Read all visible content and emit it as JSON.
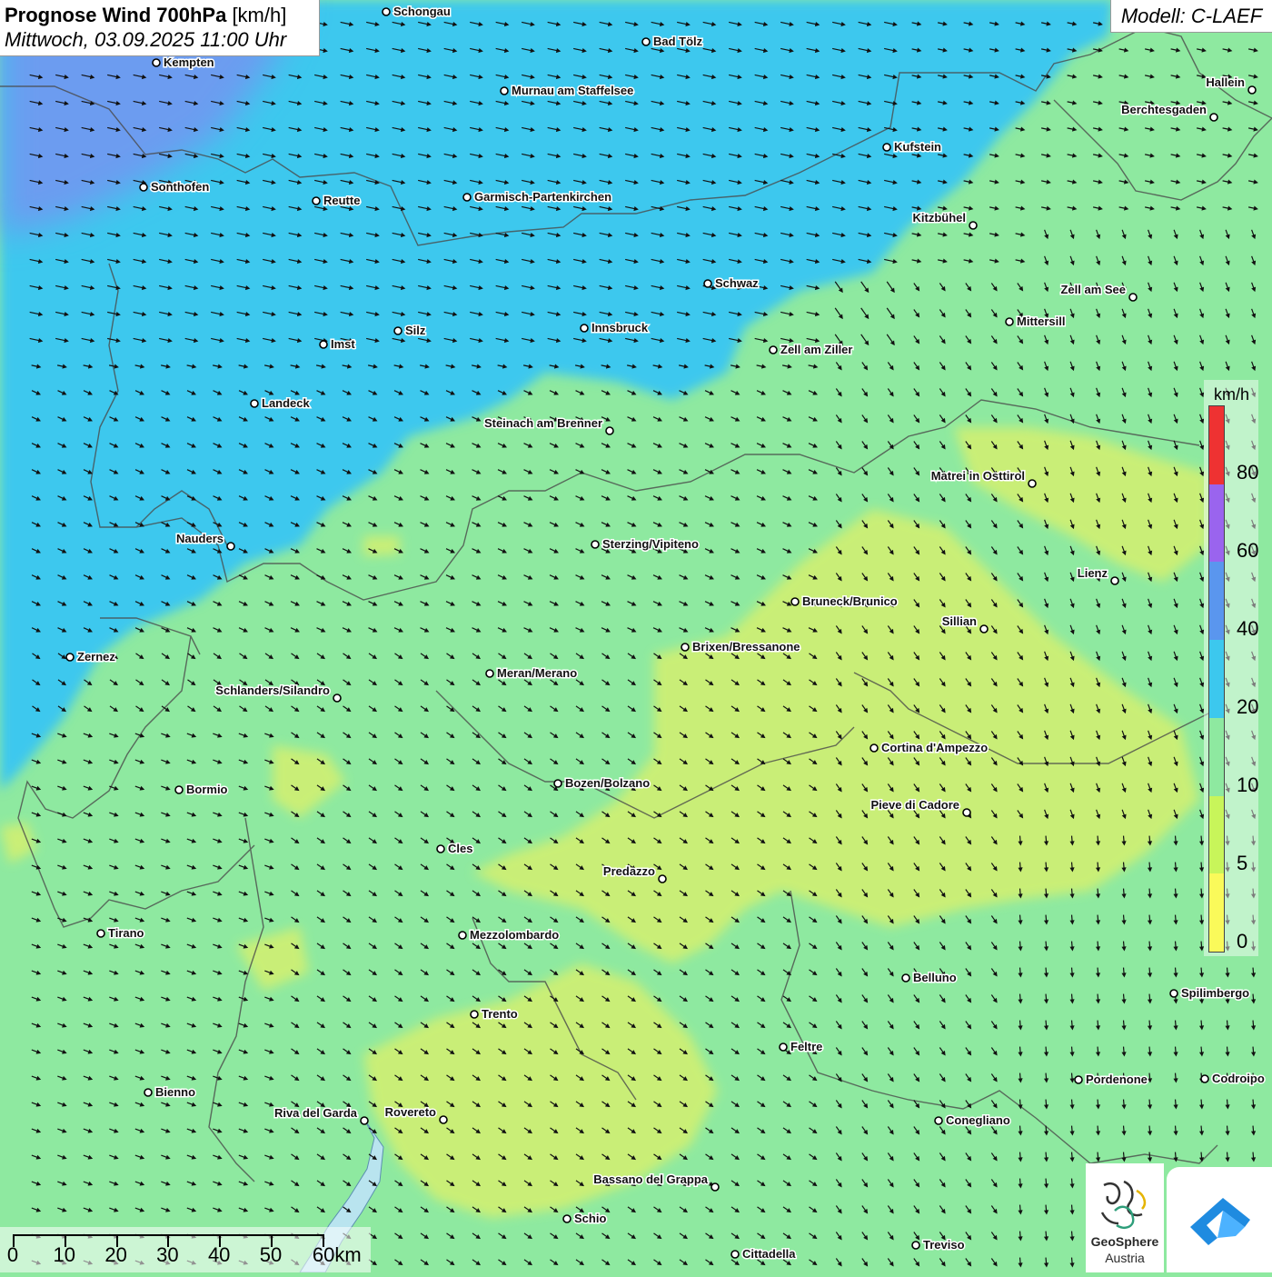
{
  "title": {
    "main": "Prognose Wind 700hPa",
    "unit": "[km/h]",
    "datetime": "Mittwoch, 03.09.2025 11:00 Uhr"
  },
  "model": "Modell: C-LAEF",
  "legend": {
    "unit": "km/h",
    "labels": [
      "0",
      "5",
      "10",
      "20",
      "40",
      "60",
      "80"
    ],
    "colors": [
      "#fafa5a",
      "#c8f55a",
      "#8ee9a0",
      "#3cc8ee",
      "#5a96ee",
      "#9a64ee",
      "#ee3232"
    ]
  },
  "scale_bar": {
    "labels": [
      "0",
      "10",
      "20",
      "30",
      "40",
      "50",
      "60km"
    ]
  },
  "logos": {
    "geosphere_line1": "GeoSphere",
    "geosphere_line2": "Austria"
  },
  "cities": [
    {
      "name": "Schongau"
    },
    {
      "name": "Bad Tölz"
    },
    {
      "name": "Kempten"
    },
    {
      "name": "Murnau am Staffelsee"
    },
    {
      "name": "Hallein"
    },
    {
      "name": "Berchtesgaden"
    },
    {
      "name": "Kufstein"
    },
    {
      "name": "Sonthofen"
    },
    {
      "name": "Reutte"
    },
    {
      "name": "Garmisch-Partenkirchen"
    },
    {
      "name": "Kitzbühel"
    },
    {
      "name": "Schwaz"
    },
    {
      "name": "Zell am See"
    },
    {
      "name": "Mittersill"
    },
    {
      "name": "Innsbruck"
    },
    {
      "name": "Imst"
    },
    {
      "name": "Silz"
    },
    {
      "name": "Zell am Ziller"
    },
    {
      "name": "Landeck"
    },
    {
      "name": "Steinach am Brenner"
    },
    {
      "name": "Matrei in Osttirol"
    },
    {
      "name": "Nauders"
    },
    {
      "name": "Sterzing/Vipiteno"
    },
    {
      "name": "Lienz"
    },
    {
      "name": "Bruneck/Brunico"
    },
    {
      "name": "Sillian"
    },
    {
      "name": "Brixen/Bressanone"
    },
    {
      "name": "Zernez"
    },
    {
      "name": "Meran/Merano"
    },
    {
      "name": "Schlanders/Silandro"
    },
    {
      "name": "Cortina d'Ampezzo"
    },
    {
      "name": "Bozen/Bolzano"
    },
    {
      "name": "Bormio"
    },
    {
      "name": "Pieve di Cadore"
    },
    {
      "name": "Cles"
    },
    {
      "name": "Predazzo"
    },
    {
      "name": "Tirano"
    },
    {
      "name": "Mezzolombardo"
    },
    {
      "name": "Belluno"
    },
    {
      "name": "Spilimbergo"
    },
    {
      "name": "Trento"
    },
    {
      "name": "Feltre"
    },
    {
      "name": "Pordenone"
    },
    {
      "name": "Codroipo"
    },
    {
      "name": "Bienno"
    },
    {
      "name": "Riva del Garda"
    },
    {
      "name": "Rovereto"
    },
    {
      "name": "Conegliano"
    },
    {
      "name": "Bassano del Grappa"
    },
    {
      "name": "Schio"
    },
    {
      "name": "Treviso"
    },
    {
      "name": "Cittadella"
    }
  ]
}
